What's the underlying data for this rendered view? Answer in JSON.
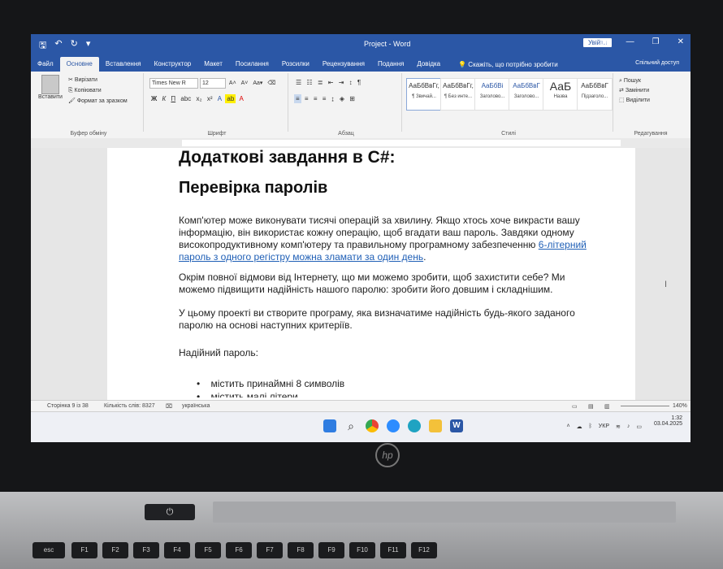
{
  "window": {
    "title": "Project - Word",
    "signin": "Увійти",
    "share": "Спільний доступ"
  },
  "tabs": [
    "Файл",
    "Основне",
    "Вставлення",
    "Конструктор",
    "Макет",
    "Посилання",
    "Розсилки",
    "Рецензування",
    "Подання",
    "Довідка"
  ],
  "tell_me": "Скажіть, що потрібно зробити",
  "ribbon": {
    "paste": "Вставити",
    "cut": "Вирізати",
    "copy": "Копіювати",
    "format_painter": "Формат за зразком",
    "clipboard_group": "Буфер обміну",
    "font_name": "Times New R",
    "font_size": "12",
    "font_group": "Шрифт",
    "paragraph_group": "Абзац",
    "styles_group": "Стилі",
    "editing_group": "Редагування",
    "find": "Пошук",
    "replace": "Замінити",
    "select": "Виділити",
    "styles": [
      {
        "sample": "АаБбВвГг,",
        "name": "¶ Звичай..."
      },
      {
        "sample": "АаБбВвГг,",
        "name": "¶ Без инте..."
      },
      {
        "sample": "АаБбВі",
        "name": "Заголово..."
      },
      {
        "sample": "АаБбВвГ",
        "name": "Заголово..."
      },
      {
        "sample": "АаБ",
        "name": "Назва"
      },
      {
        "sample": "АаБбВвГ",
        "name": "Підзаголо..."
      }
    ]
  },
  "document": {
    "heading1": "Додаткові завдання в C#:",
    "heading2": "Перевірка паролів",
    "p1_start": "Комп'ютер може виконувати тисячі операцій за хвилину. Якщо хтось хоче викрасти вашу інформацію, він використає кожну операцію, щоб вгадати ваш пароль. Завдяки одному високопродуктивному комп'ютеру та правильному програмному забезпеченню ",
    "p1_link": "6-літерний пароль з одного регістру можна зламати за один день",
    "p1_end": ".",
    "p2": "Окрім повної відмови від Інтернету, що ми можемо зробити, щоб захистити себе? Ми можемо підвищити надійність нашого паролю: зробити його довшим і складнішим.",
    "p3": "У цьому проекті ви створите програму, яка визначатиме надійність будь-якого заданого паролю на основі наступних критеріїв.",
    "p4": "Надійний пароль:",
    "bullets": [
      "містить принаймні 8 символів",
      "містить малі літери"
    ]
  },
  "status": {
    "page": "Сторінка 9 із 38",
    "words": "Кількість слів: 8327",
    "language": "українська",
    "zoom": "140%"
  },
  "tray": {
    "lang": "УКР",
    "time": "1:32",
    "date": "03.04.2025"
  },
  "laptop": {
    "brand": "hp"
  },
  "keyboard": [
    "esc",
    "F1",
    "F2",
    "F3",
    "F4",
    "F5",
    "F6",
    "F7",
    "F8",
    "F9",
    "F10",
    "F11",
    "F12"
  ]
}
